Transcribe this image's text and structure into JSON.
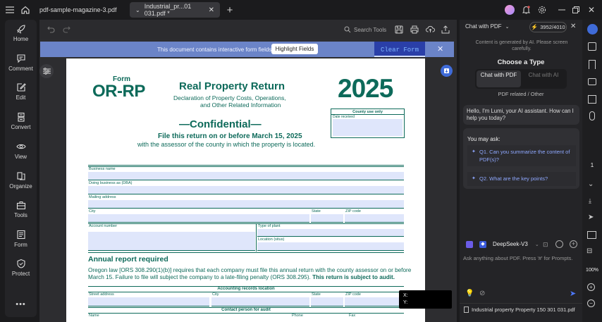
{
  "tabs": [
    {
      "label": "pdf-sample-magazine-3.pdf"
    },
    {
      "label": "Industrial_pr...01 031.pdf *"
    }
  ],
  "nav": [
    {
      "label": "Home",
      "icon": "rocket-icon"
    },
    {
      "label": "Comment",
      "icon": "comment-icon"
    },
    {
      "label": "Edit",
      "icon": "edit-icon"
    },
    {
      "label": "Convert",
      "icon": "convert-icon"
    },
    {
      "label": "View",
      "icon": "eye-icon"
    },
    {
      "label": "Organize",
      "icon": "organize-icon"
    },
    {
      "label": "Tools",
      "icon": "toolbox-icon"
    },
    {
      "label": "Form",
      "icon": "form-icon"
    },
    {
      "label": "Protect",
      "icon": "shield-icon"
    }
  ],
  "toolbar": {
    "search_label": "Search Tools"
  },
  "banner": {
    "text": "This document contains interactive form fields.",
    "highlight_label": "Highlight Fields",
    "clear_label": "Clear Form"
  },
  "form": {
    "form_label": "Form",
    "form_number": "OR-RP",
    "title": "Real Property Return",
    "subtitle1": "Declaration of Property Costs, Operations,",
    "subtitle2": "and Other Related Information",
    "year": "2025",
    "county_use": "County use only",
    "date_received": "Date received",
    "confidential": "—Confidential—",
    "file_by": "File this return on or before March 15, 2025",
    "with_assessor": "with the assessor of the county in which the property is located.",
    "business_name": "Business name",
    "dba": "Doing business as (DBA)",
    "mailing_address": "Mailing address",
    "city": "City",
    "state": "State",
    "zip": "ZIP code",
    "account_number": "Account number",
    "type_of_plant": "Type of plant",
    "location": "Location (situs)",
    "annual_heading": "Annual report required",
    "annual_text1": "Oregon law [ORS 308.290(1)(b)] requires that each company must file this annual return with the county assessor on or before",
    "annual_text2": "March 15. Failure to file will subject the company to a late-filing penalty (ORS 308.295).",
    "annual_bold": "This return is subject to audit.",
    "accounting_records": "Accounting records location",
    "street_address": "Street address",
    "city2": "City",
    "state2": "State",
    "zip2": "ZIP code",
    "contact_person": "Contact person for audit",
    "name": "Name",
    "phone": "Phone",
    "fax": "Fax"
  },
  "coords": {
    "x_label": "X:",
    "y_label": "Y:"
  },
  "chat": {
    "mode_label": "Chat with PDF",
    "credits": "3952/4010",
    "notice": "Content is generated by AI. Please screen carefully.",
    "choose_type": "Choose a Type",
    "type1": "Chat with PDF",
    "type2": "Chat with AI",
    "related": "PDF related / Other",
    "greeting": "Hello, I'm Lumi, your AI assistant. How can I help you today?",
    "you_may_ask": "You may ask:",
    "q1": "Q1. Can you summarize the content of PDF(s)?",
    "q2": "Q2. What are the key points?",
    "model": "DeepSeek-V3",
    "input_placeholder": "Ask anything about PDF. Press '#' for Prompts.",
    "attached_file": "Industrial property Property 150 301 031.pdf"
  },
  "rightstrip": {
    "page": "1",
    "zoom": "100%"
  },
  "colors": {
    "accent": "#0d6a5a",
    "banner": "#6b84c8",
    "link": "#8fa8ff"
  }
}
